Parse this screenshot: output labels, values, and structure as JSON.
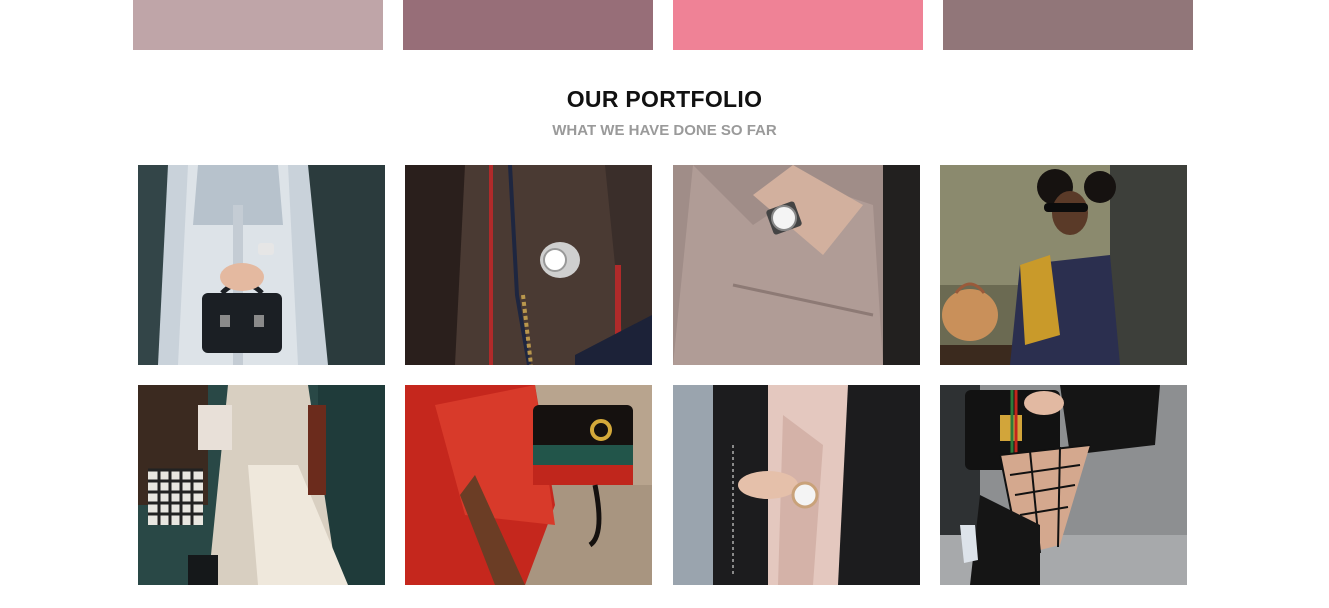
{
  "swatches": [
    {
      "name": "swatch-dusty-rose",
      "color": "#bfa5a8"
    },
    {
      "name": "swatch-mauve",
      "color": "#976e78"
    },
    {
      "name": "swatch-pink",
      "color": "#ef8296"
    },
    {
      "name": "swatch-taupe",
      "color": "#917679"
    }
  ],
  "portfolio": {
    "title": "OUR PORTFOLIO",
    "subtitle": "WHAT WE HAVE DONE SO FAR"
  }
}
